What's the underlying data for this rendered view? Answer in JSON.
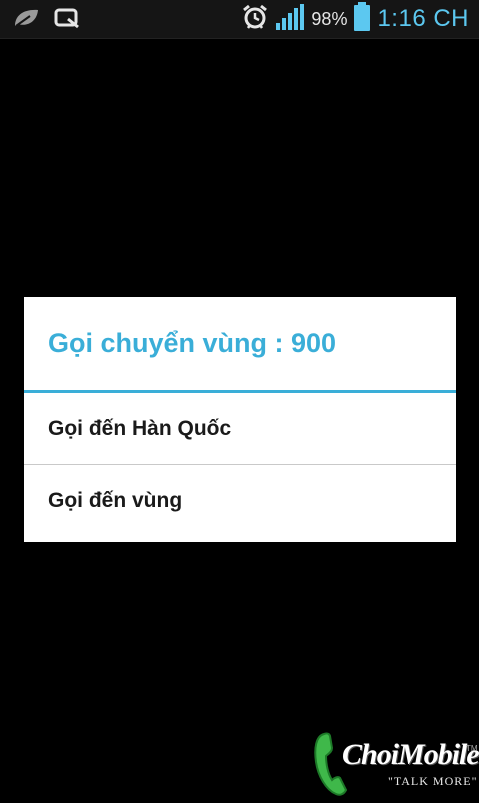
{
  "status_bar": {
    "left_icons": [
      "leaf-icon",
      "qslide-icon"
    ],
    "alarm_icon": "alarm-clock-icon",
    "signal_icon": "signal-bars-icon",
    "battery_percent": "98%",
    "battery_level": 0.98,
    "battery_icon": "battery-icon",
    "time": "1:16 CH",
    "accent_color": "#5cc8f0"
  },
  "dialog": {
    "title": "Gọi chuyển vùng : 900",
    "title_color": "#3aaed8",
    "items": [
      {
        "label": "Gọi đến Hàn Quốc"
      },
      {
        "label": "Gọi đến vùng"
      }
    ]
  },
  "watermark": {
    "brand": "ChoiMobile",
    "tagline": "\"TALK MORE\"",
    "tm": "TM"
  }
}
